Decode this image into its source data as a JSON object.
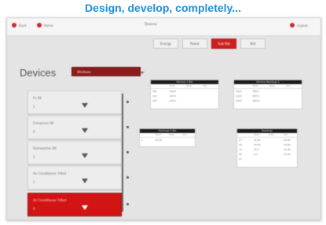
{
  "banner": {
    "title": "Design, develop, completely..."
  },
  "colors": {
    "accent": "#cc1f1f",
    "banner": "#1f8fd8"
  },
  "app": {
    "back_label": "Back",
    "home_label": "Home",
    "window_title": "Devices",
    "logout_label": "Logout",
    "tabs": [
      {
        "label": "Energy",
        "active": false
      },
      {
        "label": "Power",
        "active": false
      },
      {
        "label": "Sub-Tab",
        "active": true
      },
      {
        "label": "Net",
        "active": false
      }
    ],
    "devices_title": "Devices",
    "device_select": "Windows",
    "cards": [
      {
        "label": "Fe 06",
        "value": "1",
        "active": false
      },
      {
        "label": "Compress 08",
        "value": "0",
        "active": false
      },
      {
        "label": "Dishwasher 08",
        "value": "1",
        "active": false
      },
      {
        "label": "Air Conditioner Y-Bed",
        "value": "1",
        "active": false
      },
      {
        "label": "Air Conditioner Y-Bed",
        "value": "0",
        "active": true
      }
    ],
    "tables": [
      {
        "title": "Window 1 Bet",
        "cols": [
          "",
          "Start",
          "Stop",
          "Dur"
        ],
        "rows": [
          [
            "100",
            "230.4",
            "",
            ""
          ],
          [
            "120",
            "235.3",
            "",
            ""
          ],
          [
            "140",
            "229.1",
            "",
            ""
          ]
        ]
      },
      {
        "title": "Window Readings 2",
        "cols": [
          "",
          "Start",
          "Stop",
          "Dur"
        ],
        "rows": [
          [
            "1010",
            "480.2",
            "",
            ""
          ],
          [
            "1020",
            "487.5",
            "",
            ""
          ],
          [
            "1030",
            "489.4",
            "",
            ""
          ]
        ]
      },
      {
        "title": "Readings 3 Bet",
        "cols": [
          "",
          "Start",
          "Stop",
          "Dur"
        ],
        "rows": [
          [
            "1",
            "22.30",
            "",
            ""
          ]
        ]
      },
      {
        "title": "Readings",
        "cols": [
          "",
          "Start",
          "Stop",
          "Dur"
        ],
        "rows": [
          [
            "17",
            "22.00",
            "",
            "22.00"
          ],
          [
            "18",
            "24.00",
            "",
            "24.00"
          ],
          [
            "19",
            "35.4",
            "",
            "35.44"
          ],
          [
            "20",
            "2.1",
            "",
            "27.24"
          ],
          [
            "21",
            "",
            "",
            ""
          ]
        ]
      }
    ]
  }
}
